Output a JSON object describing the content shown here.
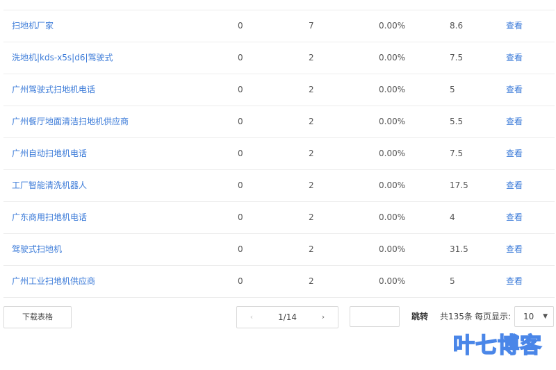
{
  "table": {
    "rows": [
      {
        "keyword": "扫地机厂家",
        "col_a": "0",
        "col_b": "7",
        "col_c": "0.00%",
        "col_d": "8.6",
        "action": "查看"
      },
      {
        "keyword": "洗地机|kds-x5s|d6|驾驶式",
        "col_a": "0",
        "col_b": "2",
        "col_c": "0.00%",
        "col_d": "7.5",
        "action": "查看"
      },
      {
        "keyword": "广州驾驶式扫地机电话",
        "col_a": "0",
        "col_b": "2",
        "col_c": "0.00%",
        "col_d": "5",
        "action": "查看"
      },
      {
        "keyword": "广州餐厅地面清洁扫地机供应商",
        "col_a": "0",
        "col_b": "2",
        "col_c": "0.00%",
        "col_d": "5.5",
        "action": "查看"
      },
      {
        "keyword": "广州自动扫地机电话",
        "col_a": "0",
        "col_b": "2",
        "col_c": "0.00%",
        "col_d": "7.5",
        "action": "查看"
      },
      {
        "keyword": "工厂智能清洗机器人",
        "col_a": "0",
        "col_b": "2",
        "col_c": "0.00%",
        "col_d": "17.5",
        "action": "查看"
      },
      {
        "keyword": "广东商用扫地机电话",
        "col_a": "0",
        "col_b": "2",
        "col_c": "0.00%",
        "col_d": "4",
        "action": "查看"
      },
      {
        "keyword": "驾驶式扫地机",
        "col_a": "0",
        "col_b": "2",
        "col_c": "0.00%",
        "col_d": "31.5",
        "action": "查看"
      },
      {
        "keyword": "广州工业扫地机供应商",
        "col_a": "0",
        "col_b": "2",
        "col_c": "0.00%",
        "col_d": "5",
        "action": "查看"
      }
    ]
  },
  "footer": {
    "download_label": "下载表格",
    "prev_icon": "‹",
    "next_icon": "›",
    "page_info": "1/14",
    "jump_value": "",
    "jump_label": "跳转",
    "total_label": "共135条",
    "per_page_label": "每页显示:",
    "per_page_value": "10",
    "caret_icon": "▼"
  },
  "watermark": {
    "text": "叶七博客",
    "color": "#4a86e8"
  },
  "colors": {
    "link": "#3a7ad8",
    "border": "#ececec"
  }
}
